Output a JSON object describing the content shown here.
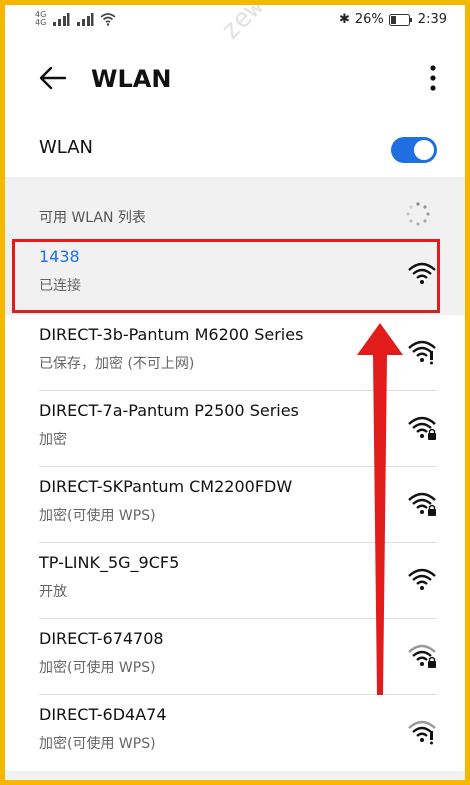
{
  "status_bar": {
    "sim_labels": [
      "4G",
      "4G"
    ],
    "battery": "26%",
    "time": "2:39"
  },
  "app_bar": {
    "title": "WLAN"
  },
  "wlan_toggle": {
    "label": "WLAN",
    "on": true
  },
  "list": {
    "header": "可用 WLAN 列表",
    "networks": [
      {
        "name": "1438",
        "status": "已连接"
      },
      {
        "name": "DIRECT-3b-Pantum M6200 Series",
        "status": "已保存，加密 (不可上网)"
      },
      {
        "name": "DIRECT-7a-Pantum P2500 Series",
        "status": "加密"
      },
      {
        "name": "DIRECT-SKPantum CM2200FDW",
        "status": "加密(可使用 WPS)"
      },
      {
        "name": "TP-LINK_5G_9CF5",
        "status": "开放"
      },
      {
        "name": "DIRECT-674708",
        "status": "加密(可使用 WPS)"
      },
      {
        "name": "DIRECT-6D4A74",
        "status": "加密(可使用 WPS)"
      }
    ]
  },
  "watermark": "zewei.lin2022-03-2",
  "colors": {
    "accent": "#1a73e8",
    "highlight": "#e21b1b",
    "frame": "#f5b700"
  }
}
